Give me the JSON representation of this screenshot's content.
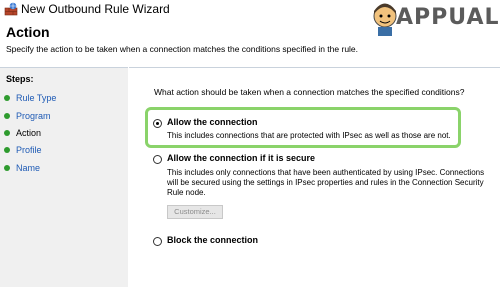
{
  "window": {
    "title": "New Outbound Rule Wizard"
  },
  "watermark": {
    "text": "APPUALS"
  },
  "page": {
    "heading": "Action",
    "description": "Specify the action to be taken when a connection matches the conditions specified in the rule."
  },
  "steps": {
    "label": "Steps:",
    "items": [
      {
        "label": "Rule Type"
      },
      {
        "label": "Program"
      },
      {
        "label": "Action"
      },
      {
        "label": "Profile"
      },
      {
        "label": "Name"
      }
    ],
    "current": "Action"
  },
  "main": {
    "question": "What action should be taken when a connection matches the specified conditions?",
    "options": [
      {
        "label": "Allow the connection",
        "description": "This includes connections that are protected with IPsec as well as those are not.",
        "selected": true
      },
      {
        "label": "Allow the connection if it is secure",
        "description_lines": [
          "This includes only connections that have been authenticated by using IPsec.  Connections",
          "will be secured using the settings in IPsec properties and rules in the Connection Security",
          "Rule node."
        ],
        "selected": false
      },
      {
        "label": "Block the connection",
        "selected": false
      }
    ],
    "customize_label": "Customize..."
  },
  "colors": {
    "highlight": "#8ad36a",
    "step_bullet": "#2e9b2e",
    "link": "#1f5bb5",
    "panel_bg": "#f0f0f0"
  }
}
